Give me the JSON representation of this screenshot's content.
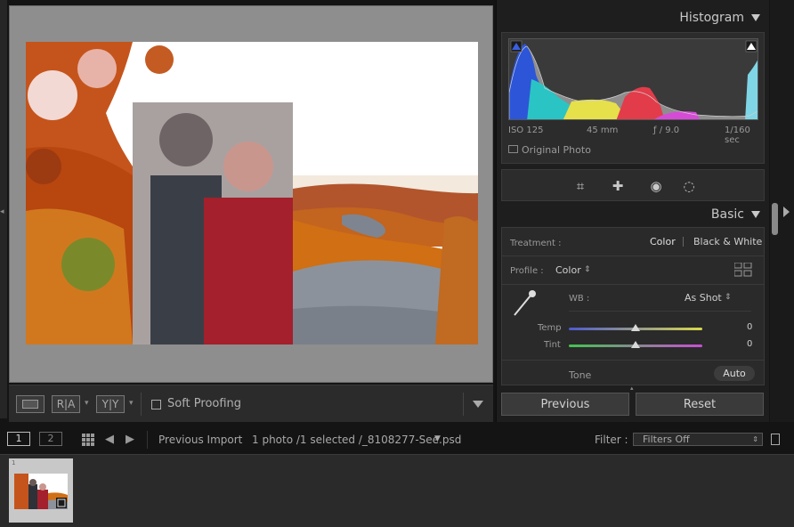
{
  "right_panel": {
    "histogram_title": "Histogram",
    "hist_iso": "ISO 125",
    "hist_focal": "45 mm",
    "hist_aperture": "ƒ / 9.0",
    "hist_shutter": "1/160 sec",
    "original_photo_label": "Original Photo",
    "basic_title": "Basic",
    "treatment_label": "Treatment :",
    "treatment_color": "Color",
    "treatment_bw": "Black & White",
    "profile_label": "Profile :",
    "profile_value": "Color",
    "wb_label": "WB :",
    "wb_value": "As Shot",
    "temp_label": "Temp",
    "temp_value": "0",
    "tint_label": "Tint",
    "tint_value": "0",
    "tone_label": "Tone",
    "auto_label": "Auto",
    "previous_label": "Previous",
    "reset_label": "Reset"
  },
  "toolbar": {
    "soft_proofing_label": "Soft Proofing",
    "ra_label": "R|A",
    "yy_label": "Y|Y"
  },
  "filmstrip_bar": {
    "view1": "1",
    "view2": "2",
    "source_label": "Previous Import",
    "selection_info": "1 photo /1 selected /_8108277-See.psd",
    "filter_label": "Filter :",
    "filter_value": "Filters Off"
  },
  "filmstrip": {
    "thumb_index": "1"
  },
  "colors": {
    "panel_bg": "#1e1e1e",
    "accent": "#c8c8c8"
  }
}
